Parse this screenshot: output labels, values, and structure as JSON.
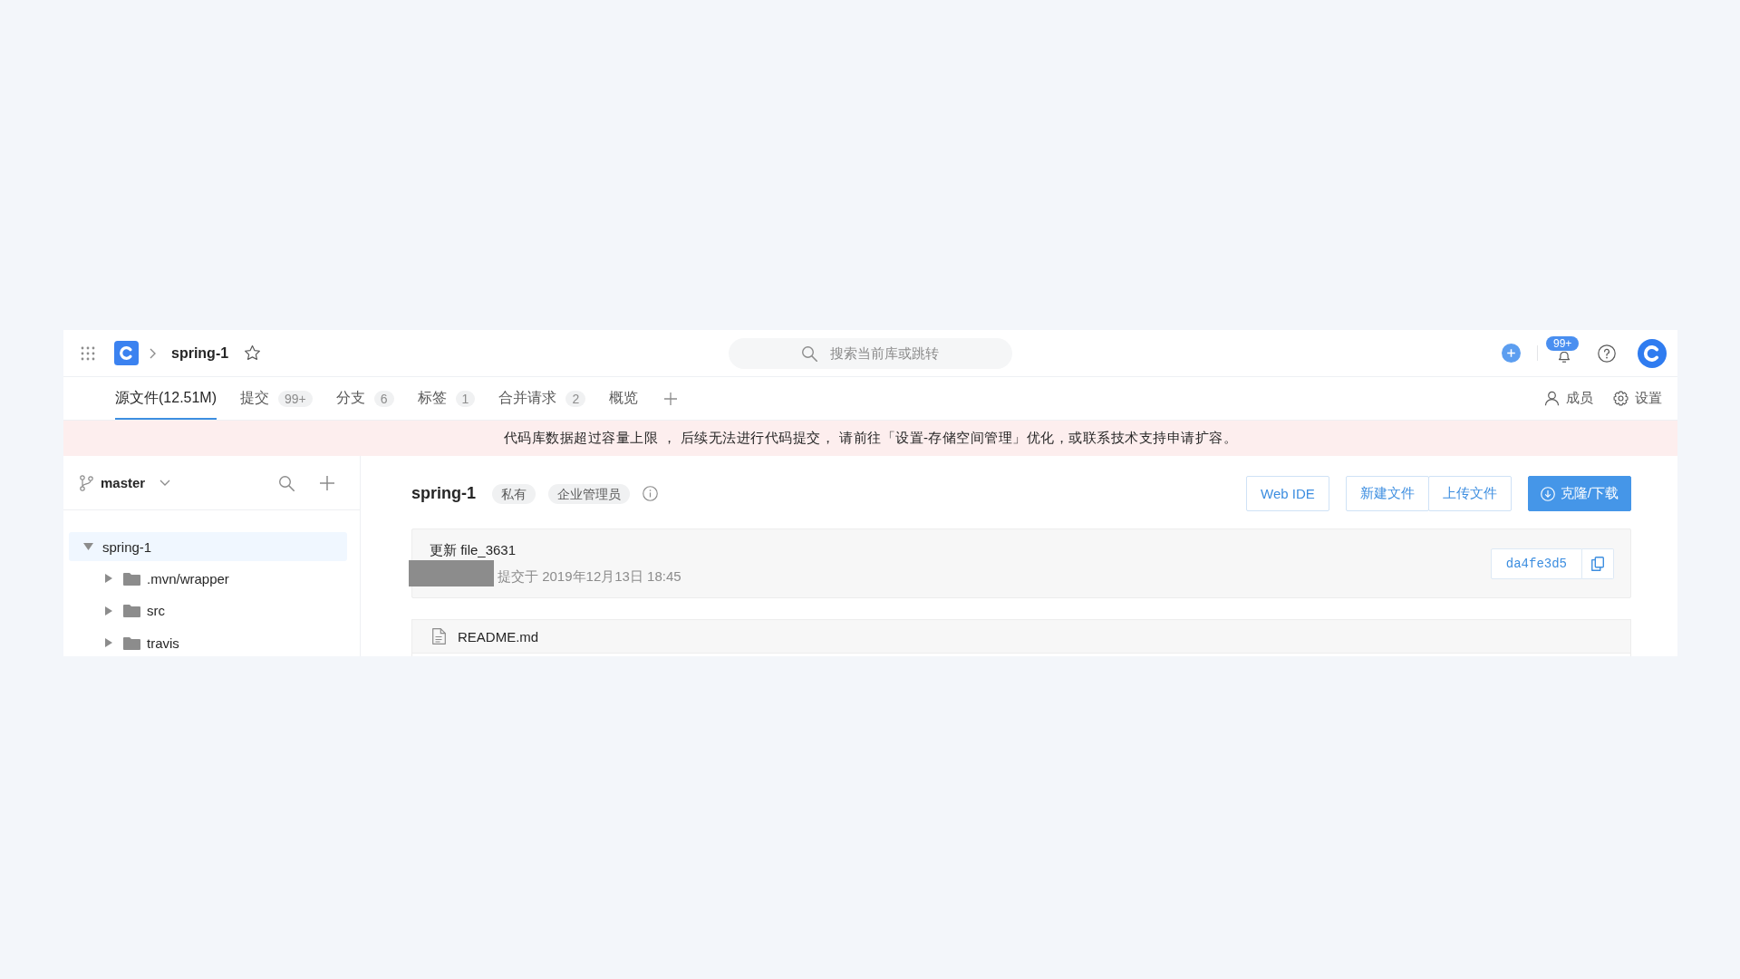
{
  "header": {
    "project": "spring-1",
    "starred": false,
    "search": {
      "placeholder": "搜索当前库或跳转"
    },
    "notification_count": "99+"
  },
  "tabs": [
    {
      "label": "源文件(12.51M)",
      "selected": true
    },
    {
      "label": "提交",
      "count": "99+",
      "selected": false
    },
    {
      "label": "分支",
      "count": "6",
      "selected": false
    },
    {
      "label": "标签",
      "count": "1",
      "selected": false
    },
    {
      "label": "合并请求",
      "count": "2",
      "selected": false
    },
    {
      "label": "概览",
      "selected": false
    }
  ],
  "tab_actions": [
    {
      "label": "成员",
      "kind": "members"
    },
    {
      "label": "设置",
      "kind": "settings"
    }
  ],
  "banner": {
    "text": "代码库数据超过容量上限 ， 后续无法进行代码提交， 请前往「设置-存储空间管理」优化，或联系技术支持申请扩容。"
  },
  "sidebar": {
    "branch": "master",
    "tree": [
      {
        "name": "spring-1",
        "kind": "repo",
        "expanded": true,
        "selected": true,
        "children": [
          {
            "name": ".mvn/wrapper",
            "kind": "folder",
            "expanded": false,
            "selected": false
          },
          {
            "name": "src",
            "kind": "folder",
            "expanded": false,
            "selected": false
          },
          {
            "name": "travis",
            "kind": "folder",
            "expanded": false,
            "selected": false
          }
        ]
      }
    ]
  },
  "repo": {
    "name": "spring-1",
    "badges": [
      "私有",
      "企业管理员"
    ]
  },
  "button_groups": [
    {
      "buttons": [
        {
          "label": "Web IDE",
          "kind": "default"
        }
      ]
    },
    {
      "buttons": [
        {
          "label": "新建文件",
          "kind": "default"
        },
        {
          "label": "上传文件",
          "kind": "default"
        }
      ]
    },
    {
      "buttons": [
        {
          "label": "克隆/下载",
          "kind": "primary"
        }
      ]
    }
  ],
  "last_commit": {
    "message": "更新 file_3631",
    "meta": "提交于 2019年12月13日 18:45",
    "hash": "da4fe3d5"
  },
  "files": [
    {
      "name": "README.md",
      "kind": "file"
    }
  ]
}
